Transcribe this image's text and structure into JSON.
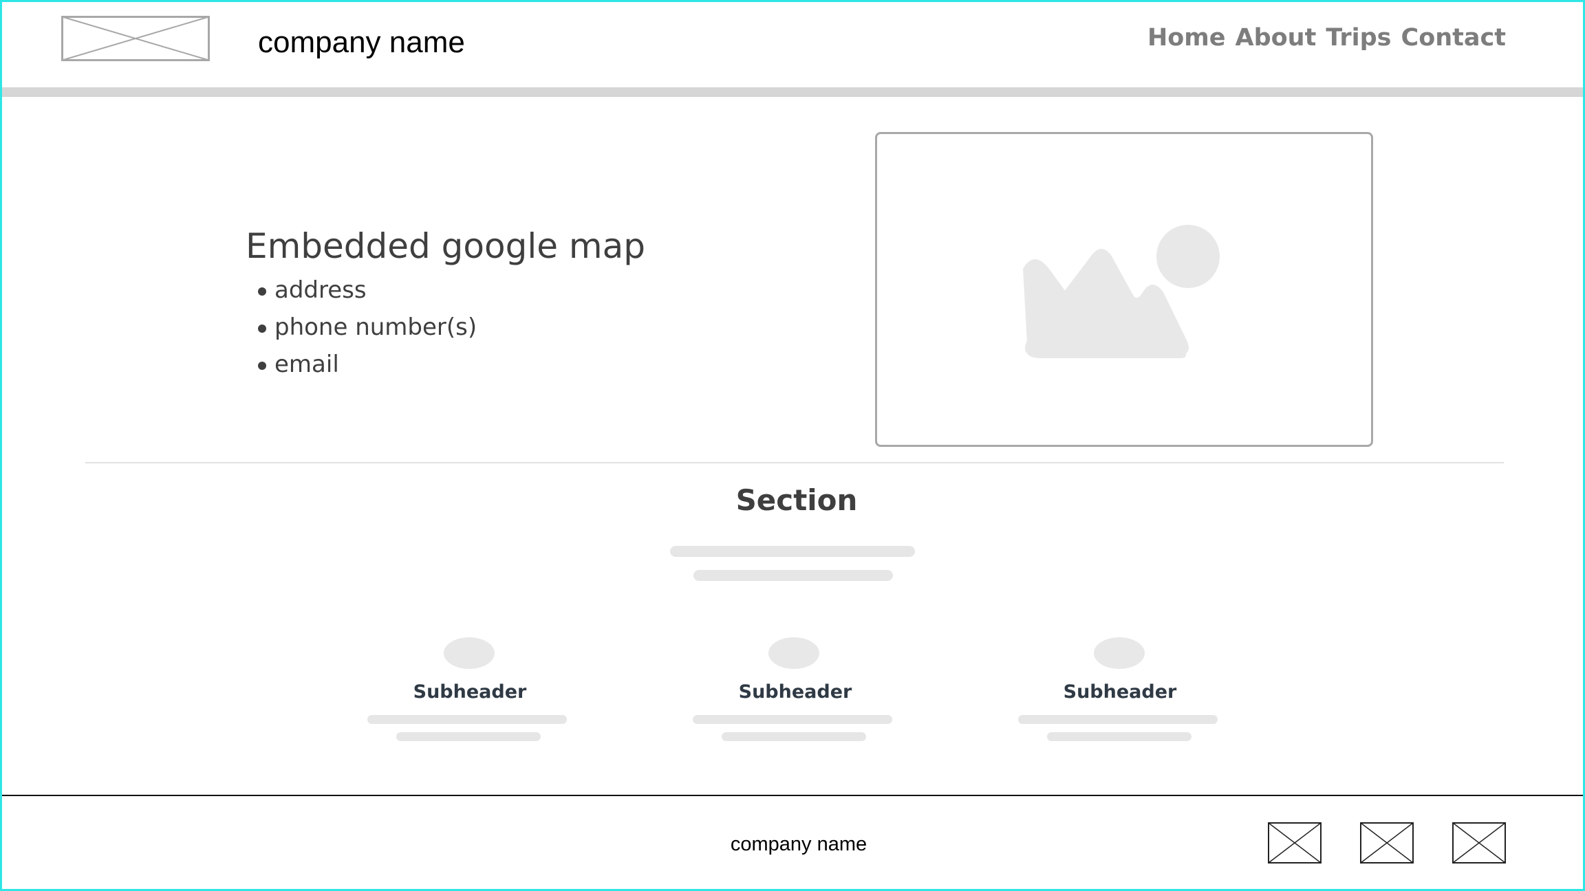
{
  "header": {
    "company_name": "company name",
    "nav": [
      "Home",
      "About",
      "Trips",
      "Contact"
    ]
  },
  "contact": {
    "title": "Embedded google map",
    "items": [
      "address",
      "phone number(s)",
      "email"
    ],
    "map_icon": "image-placeholder-icon"
  },
  "section": {
    "title": "Section",
    "features": [
      {
        "subheader": "Subheader"
      },
      {
        "subheader": "Subheader"
      },
      {
        "subheader": "Subheader"
      }
    ]
  },
  "footer": {
    "company_name": "company name",
    "social_icons": [
      "image-placeholder-icon",
      "image-placeholder-icon",
      "image-placeholder-icon"
    ]
  },
  "colors": {
    "frame_border": "#2ee6e6",
    "header_bar": "#d6d6d6",
    "nav_text": "#7d7d7d",
    "heading_text": "#3f3f3f",
    "placeholder_fill": "#e8e8e8"
  }
}
